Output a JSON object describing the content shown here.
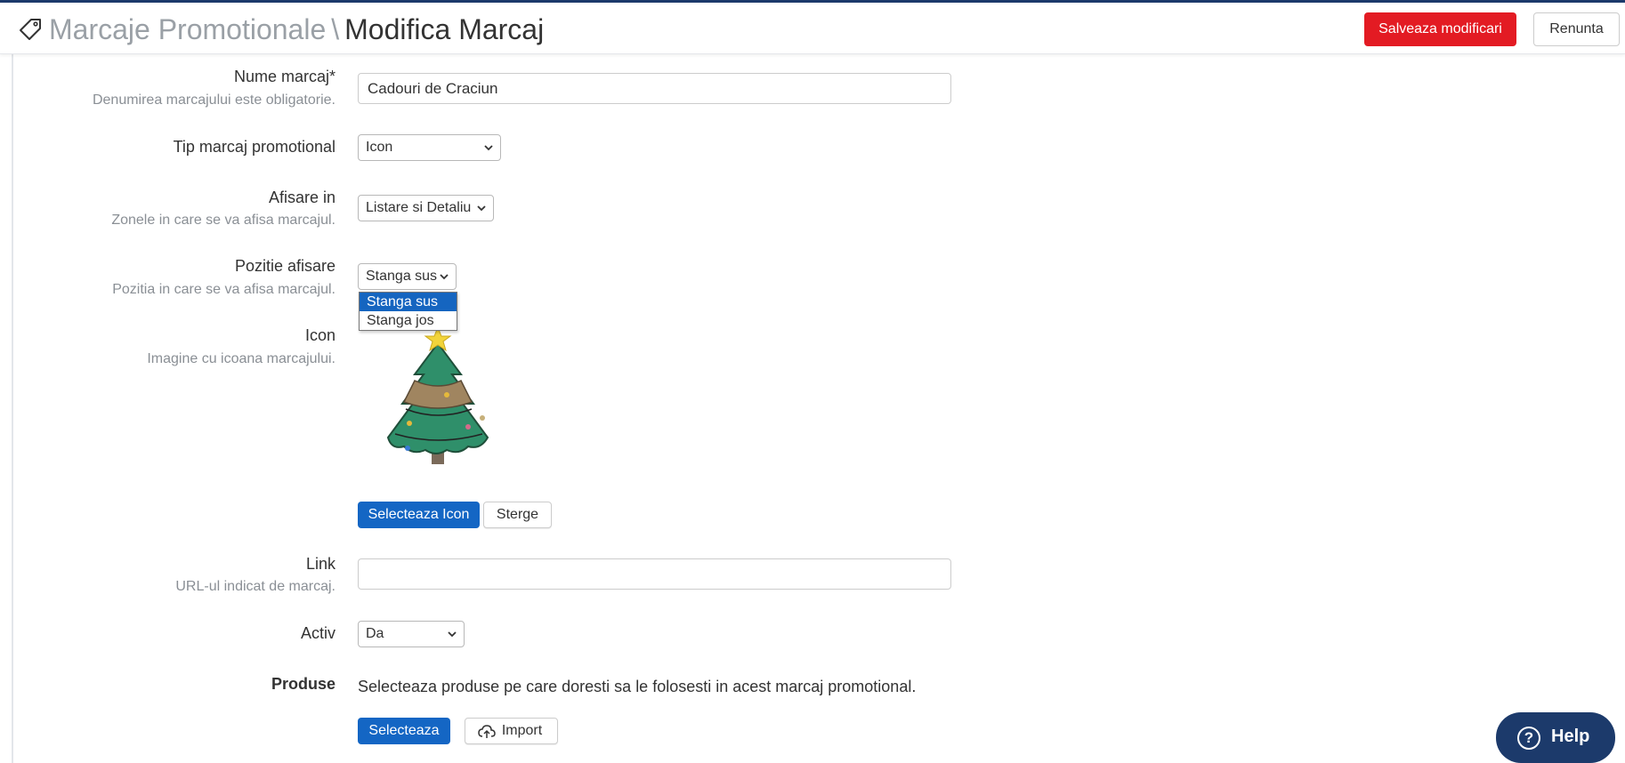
{
  "header": {
    "breadcrumb_parent": "Marcaje Promotionale",
    "breadcrumb_separator": "\\",
    "breadcrumb_current": "Modifica Marcaj",
    "save_label": "Salveaza modificari",
    "cancel_label": "Renunta"
  },
  "form": {
    "name": {
      "label": "Nume marcaj*",
      "hint": "Denumirea marcajului este obligatorie.",
      "value": "Cadouri de Craciun"
    },
    "type": {
      "label": "Tip marcaj promotional",
      "value": "Icon"
    },
    "display_in": {
      "label": "Afisare in",
      "hint": "Zonele in care se va afisa marcajul.",
      "value": "Listare si Detaliu"
    },
    "position": {
      "label": "Pozitie afisare",
      "hint": "Pozitia in care se va afisa marcajul.",
      "value": "Stanga sus",
      "options": [
        "Stanga sus",
        "Stanga jos"
      ]
    },
    "icon": {
      "label": "Icon",
      "hint": "Imagine cu icoana marcajului.",
      "select_label": "Selecteaza Icon",
      "delete_label": "Sterge"
    },
    "link": {
      "label": "Link",
      "hint": "URL-ul indicat de marcaj.",
      "value": ""
    },
    "active": {
      "label": "Activ",
      "value": "Da"
    },
    "products": {
      "label": "Produse",
      "text": "Selecteaza produse pe care doresti sa le folosesti in acest marcaj promotional.",
      "select_label": "Selecteaza",
      "import_label": "Import"
    }
  },
  "help": {
    "label": "Help"
  },
  "colors": {
    "primary": "#1466c4",
    "danger": "#e31b23",
    "navy": "#1c3a6b"
  }
}
